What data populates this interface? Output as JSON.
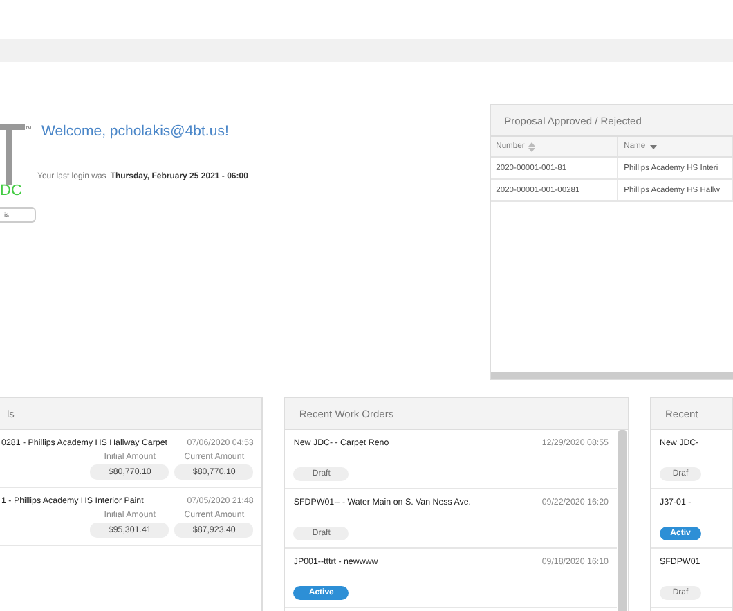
{
  "welcome": {
    "logo_suffix": "DC",
    "trademark": "™",
    "greeting": "Welcome, pcholakis@4bt.us!",
    "login_label": "Your last login was",
    "login_time": "Thursday, February 25 2021 - 06:00",
    "field_value": "is"
  },
  "proposal_panel": {
    "title": "Proposal Approved / Rejected",
    "columns": [
      {
        "label": "Number",
        "kind": "sortable"
      },
      {
        "label": "Name",
        "kind": "descending"
      }
    ],
    "rows": [
      [
        "2020-00001-001-81",
        "Phillips Academy HS Interi"
      ],
      [
        "2020-00001-001-00281",
        "Phillips Academy HS Hallw"
      ]
    ]
  },
  "proposals_panel": {
    "title": "ls",
    "items": [
      {
        "title": "0281 - Phillips Academy HS Hallway Carpet",
        "date": "07/06/2020 04:53",
        "initial_label": "Initial Amount",
        "initial": "$80,770.10",
        "current_label": "Current Amount",
        "current": "$80,770.10"
      },
      {
        "title": "1 - Phillips Academy HS Interior Paint",
        "date": "07/05/2020 21:48",
        "initial_label": "Initial Amount",
        "initial": "$95,301.41",
        "current_label": "Current Amount",
        "current": "$87,923.40"
      }
    ]
  },
  "work_orders_panel": {
    "title": "Recent Work Orders",
    "items": [
      {
        "title": "New JDC- - Carpet Reno",
        "date": "12/29/2020 08:55",
        "status": "Draft",
        "kind": "draft"
      },
      {
        "title": "SFDPW01-- - Water Main on S. Van Ness Ave.",
        "date": "09/22/2020 16:20",
        "status": "Draft",
        "kind": "draft"
      },
      {
        "title": "JP001--tttrt - newwww",
        "date": "09/18/2020 16:10",
        "status": "Active",
        "kind": "active"
      }
    ]
  },
  "third_panel": {
    "title": "Recent",
    "items": [
      {
        "title": "New JDC-",
        "status": "Draf",
        "kind": "draft"
      },
      {
        "title": "J37-01 -",
        "status": "Activ",
        "kind": "active"
      },
      {
        "title": "SFDPW01",
        "status": "Draf",
        "kind": "draft"
      }
    ]
  }
}
